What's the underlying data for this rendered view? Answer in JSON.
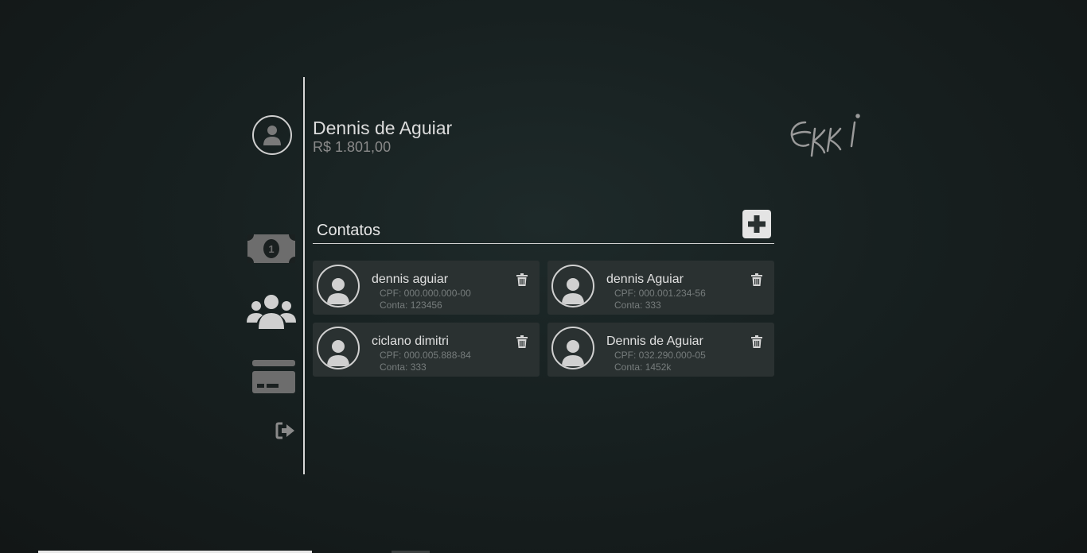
{
  "user": {
    "name": "Dennis de Aguiar",
    "balance": "R$ 1.801,00"
  },
  "logo": {
    "text": "Ekki"
  },
  "nav": {
    "items": [
      {
        "name": "money",
        "icon": "money-bill-icon"
      },
      {
        "name": "contacts",
        "icon": "users-icon"
      },
      {
        "name": "card",
        "icon": "credit-card-icon"
      },
      {
        "name": "logout",
        "icon": "sign-out-icon"
      }
    ]
  },
  "contacts": {
    "title": "Contatos",
    "add_icon": "plus-icon",
    "items": [
      {
        "name": "dennis aguiar",
        "cpf": "CPF: 000.000.000-00",
        "conta": "Conta: 123456"
      },
      {
        "name": "dennis Aguiar",
        "cpf": "CPF: 000.001.234-56",
        "conta": "Conta: 333"
      },
      {
        "name": "ciclano dimitri",
        "cpf": "CPF: 000.005.888-84",
        "conta": "Conta: 333"
      },
      {
        "name": "Dennis de Aguiar",
        "cpf": "CPF: 032.290.000-05",
        "conta": "Conta: 1452k"
      }
    ]
  },
  "colors": {
    "background": "#172020",
    "card": "#2a3131",
    "accent": "#e4e4e4",
    "muted": "#767c7c"
  }
}
